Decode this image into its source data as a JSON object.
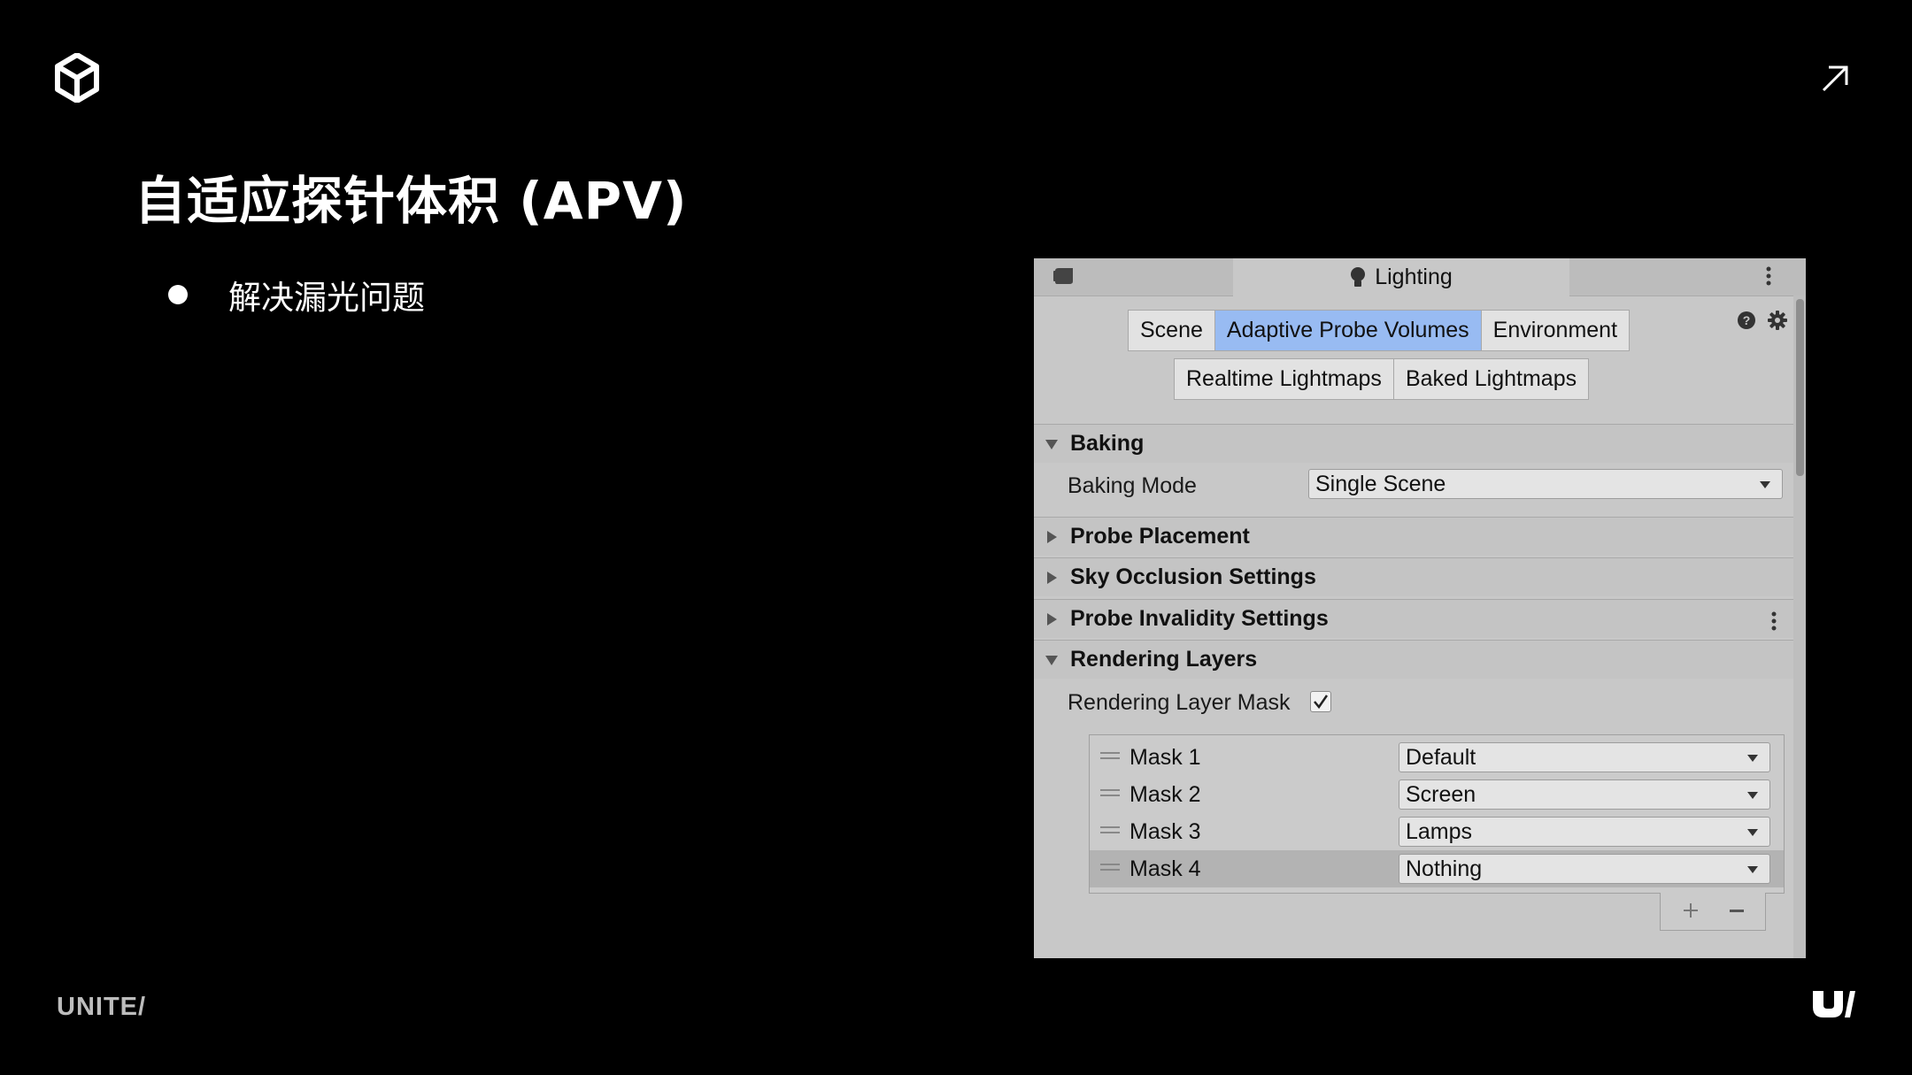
{
  "slide": {
    "title": "自适应探针体积 (APV)",
    "bullets": [
      "解决漏光问题"
    ],
    "footer_brand": "UNITE/"
  },
  "icons": {
    "top_left": "unity-logo-icon",
    "top_right": "arrow-up-right-icon",
    "bottom_right": "unite-u-mark-icon"
  },
  "lighting_window": {
    "tab_title": "Lighting",
    "tabs_row1": [
      "Scene",
      "Adaptive Probe Volumes",
      "Environment"
    ],
    "tabs_row2": [
      "Realtime Lightmaps",
      "Baked Lightmaps"
    ],
    "active_tab": "Adaptive Probe Volumes",
    "sections": {
      "baking": {
        "title": "Baking",
        "expanded": true,
        "baking_mode_label": "Baking Mode",
        "baking_mode_value": "Single Scene"
      },
      "probe_placement": {
        "title": "Probe Placement",
        "expanded": false
      },
      "sky_occlusion": {
        "title": "Sky Occlusion Settings",
        "expanded": false
      },
      "probe_invalidity": {
        "title": "Probe Invalidity Settings",
        "expanded": false
      },
      "rendering_layers": {
        "title": "Rendering Layers",
        "expanded": true,
        "mask_label": "Rendering Layer Mask",
        "mask_checked": true,
        "masks": [
          {
            "name": "Mask 1",
            "value": "Default"
          },
          {
            "name": "Mask 2",
            "value": "Screen"
          },
          {
            "name": "Mask 3",
            "value": "Lamps"
          },
          {
            "name": "Mask 4",
            "value": "Nothing"
          }
        ],
        "selected_mask": "Mask 4"
      }
    },
    "colors": {
      "panel": "#c8c8c8",
      "active_tab": "#98bbf2"
    }
  }
}
